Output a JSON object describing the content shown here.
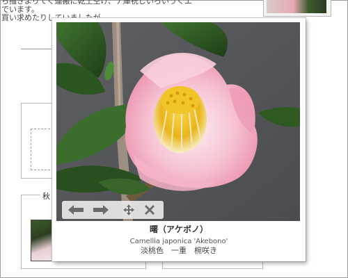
{
  "background_page": {
    "text_lines": [
      "ら描きよりてく運搬に乾土空け、ナ庫祝じいろいうくエ",
      "でいます。",
      "買い求めたりしていましたが、"
    ],
    "box2_legend": "秋"
  },
  "lightbox": {
    "title": "曙（アケボノ）",
    "latin_name": "Camellia japonica 'Akebono'",
    "description": "淡桃色　一重　椀咲き",
    "toolbar": {
      "prev_icon": "arrow-left-icon",
      "next_icon": "arrow-right-icon",
      "move_icon": "move-icon",
      "close_icon": "close-icon"
    }
  },
  "colors": {
    "photo_background": "#56595d",
    "petal_pink": "#f2b2c4",
    "stamen_yellow": "#f0c21e",
    "leaf_green": "#2f5a24",
    "toolbar_bg": "#e8e8e8",
    "icon_gray": "#6a6a6a"
  }
}
